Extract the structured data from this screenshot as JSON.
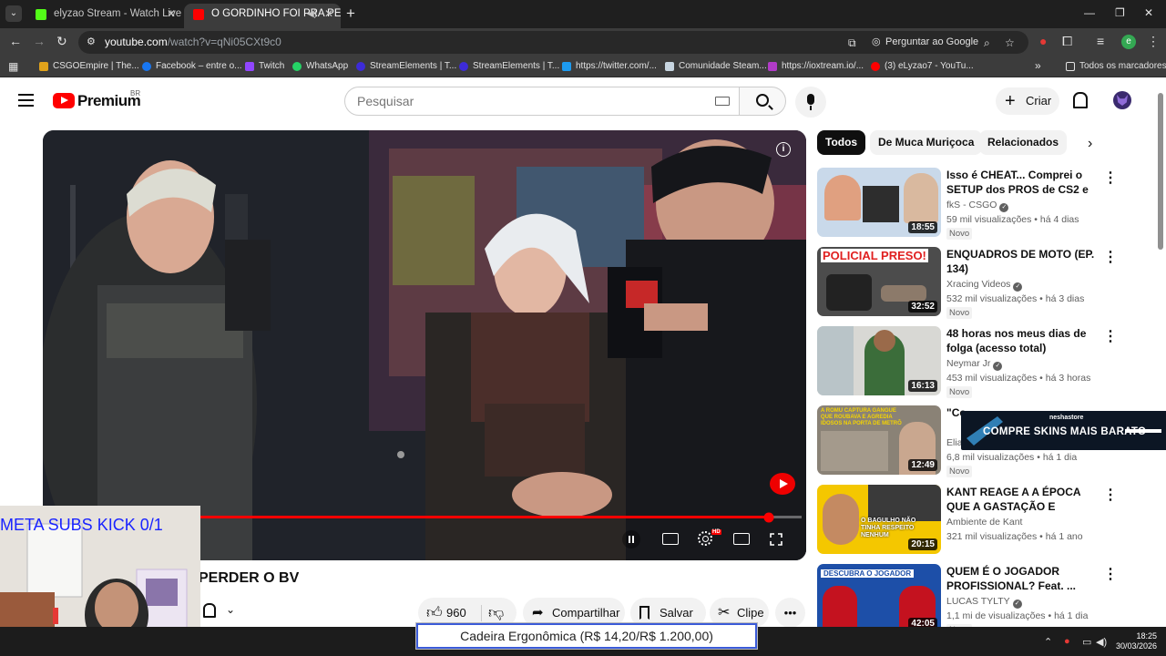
{
  "browser": {
    "tabs": [
      {
        "title": "elyzao Stream - Watch Live on",
        "favicon_color": "#53fc18"
      },
      {
        "title": "O GORDINHO FOI PRA PER",
        "favicon_color": "#ff0000"
      }
    ],
    "url_host": "youtube.com",
    "url_path": "/watch?v=qNi05CXt9c0",
    "ask_google": "Perguntar ao Google",
    "profile_initial": "e",
    "bookmarks": [
      {
        "label": "CSGOEmpire | The...",
        "color": "#e0a21b"
      },
      {
        "label": "Facebook – entre o...",
        "color": "#1877f2"
      },
      {
        "label": "Twitch",
        "color": "#9146ff"
      },
      {
        "label": "WhatsApp",
        "color": "#25d366"
      },
      {
        "label": "StreamElements | T...",
        "color": "#3d2bd8"
      },
      {
        "label": "StreamElements | T...",
        "color": "#3d2bd8"
      },
      {
        "label": "https://twitter.com/...",
        "color": "#1d9bf0"
      },
      {
        "label": "Comunidade Steam...",
        "color": "#1b2838"
      },
      {
        "label": "https://ioxtream.io/...",
        "color": "#b23bc8"
      },
      {
        "label": "(3) eLyzao7 - YouTu...",
        "color": "#ff0000"
      }
    ],
    "all_bookmarks": "Todos os marcadores"
  },
  "youtube": {
    "brand": "Premium",
    "region": "BR",
    "search_placeholder": "Pesquisar",
    "create_label": "Criar",
    "video": {
      "title": "PERDER O BV",
      "progress": 0.945,
      "likes": "960",
      "share_label": "Compartilhar",
      "save_label": "Salvar",
      "clip_label": "Clipe",
      "more_label": "•••"
    },
    "chips": [
      "Todos",
      "De Muca Muriçoca",
      "Relacionados"
    ],
    "recommendations": [
      {
        "title": "Isso é CHEAT... Comprei o SETUP dos PROS de CS2 e fui ...",
        "channel": "fkS - CSGO",
        "verified": true,
        "views": "59 mil visualizações",
        "age": "há 4 dias",
        "badge": "Novo",
        "duration": "18:55",
        "thumb": [
          "#c9d9ea",
          "#e53935"
        ]
      },
      {
        "title": "ENQUADROS DE MOTO (EP. 134)",
        "channel": "Xracing Videos",
        "verified": true,
        "views": "532 mil visualizações",
        "age": "há 3 dias",
        "badge": "Novo",
        "duration": "32:52",
        "thumb": [
          "#4c4c4c",
          "#e02020"
        ]
      },
      {
        "title": "48 horas nos meus dias de folga (acesso total)",
        "channel": "Neymar Jr",
        "verified": true,
        "views": "453 mil visualizações",
        "age": "há 3 horas",
        "badge": "Novo",
        "duration": "16:13",
        "thumb": [
          "#d8d8d4",
          "#3b6d3a"
        ]
      },
      {
        "title": "\"Co...",
        "channel": "Elia...",
        "verified": false,
        "views": "6,8 mil visualizações",
        "age": "há 1 dia",
        "badge": "Novo",
        "duration": "12:49",
        "thumb": [
          "#8a8276",
          "#f5d400"
        ]
      },
      {
        "title": "KANT REAGE A A ÉPOCA QUE A GASTAÇÃO E PEDERASTIA ...",
        "channel": "Ambiente de Kant",
        "verified": false,
        "views": "321 mil visualizações",
        "age": "há 1 ano",
        "badge": "",
        "duration": "20:15",
        "thumb": [
          "#f4c700",
          "#2a2a2a"
        ]
      },
      {
        "title": "QUEM É O JOGADOR PROFISSIONAL? Feat. ...",
        "channel": "LUCAS TYLTY",
        "verified": true,
        "views": "1,1 mi de visualizações",
        "age": "há 1 dia",
        "badge": "Novo",
        "duration": "42:05",
        "thumb": [
          "#1d4fa8",
          "#c4121f"
        ]
      }
    ],
    "thumb_text": {
      "policial": "POLICIAL PRESO!",
      "romu": "A ROMU CAPTURA GANGUE QUE ROUBAVA E AGREDIA IDOSOS NA PORTA DE METRÔ",
      "kant": "O BAGULHO NÃO TINHA RESPEITO NENHUM",
      "descubra": "DESCUBRA O JOGADOR"
    }
  },
  "overlays": {
    "ad_brand": "neshastore",
    "ad_text": "COMPRE SKINS MAIS BARATO",
    "sub_goal": "META SUBS KICK 0/1",
    "donation_goal": "Cadeira Ergonômica (R$ 14,20/R$ 1.200,00)"
  },
  "system": {
    "time": "18:25",
    "date": "30/03/2026"
  }
}
